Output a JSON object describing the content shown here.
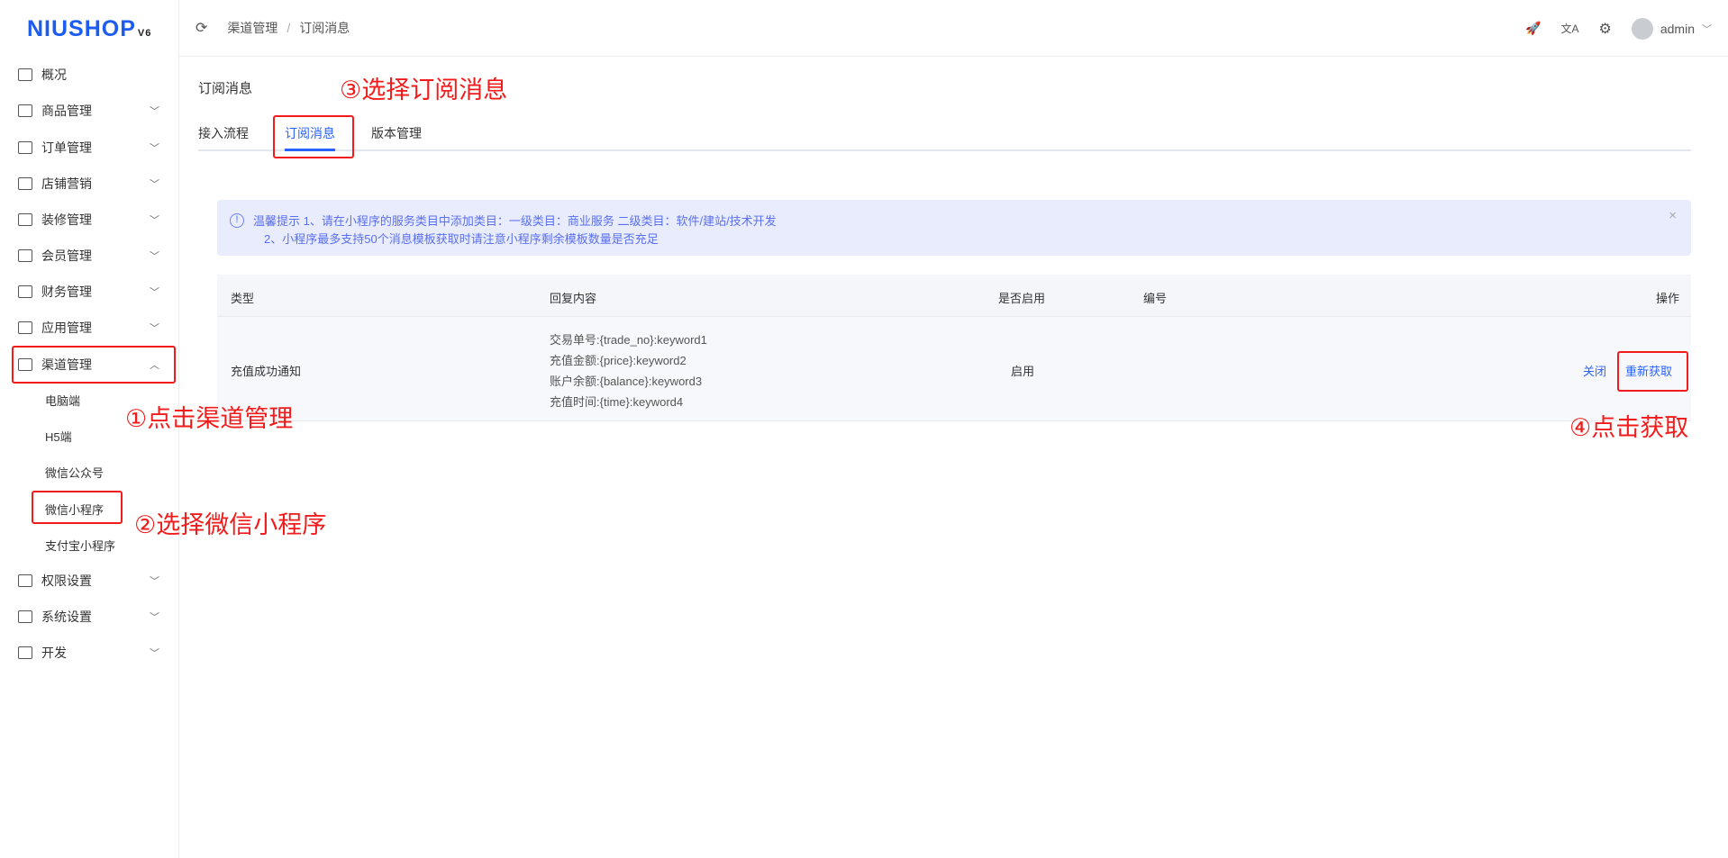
{
  "logo": {
    "text": "NIUSHOP",
    "version": "V6"
  },
  "sidebar": {
    "items": [
      {
        "label": "概况",
        "icon": "chart-icon"
      },
      {
        "label": "商品管理",
        "icon": "goods-icon"
      },
      {
        "label": "订单管理",
        "icon": "order-icon"
      },
      {
        "label": "店铺营销",
        "icon": "marketing-icon"
      },
      {
        "label": "装修管理",
        "icon": "decorate-icon"
      },
      {
        "label": "会员管理",
        "icon": "member-icon"
      },
      {
        "label": "财务管理",
        "icon": "finance-icon"
      },
      {
        "label": "应用管理",
        "icon": "app-icon"
      },
      {
        "label": "渠道管理",
        "icon": "channel-icon"
      },
      {
        "label": "权限设置",
        "icon": "permission-icon"
      },
      {
        "label": "系统设置",
        "icon": "settings-icon"
      },
      {
        "label": "开发",
        "icon": "develop-icon"
      }
    ],
    "channel_sub": [
      "电脑端",
      "H5端",
      "微信公众号",
      "微信小程序",
      "支付宝小程序"
    ]
  },
  "header": {
    "breadcrumb": [
      "渠道管理",
      "/",
      "订阅消息"
    ],
    "user": "admin"
  },
  "page": {
    "title": "订阅消息",
    "tabs": [
      "接入流程",
      "订阅消息",
      "版本管理"
    ]
  },
  "alert": {
    "line1": "温馨提示 1、请在小程序的服务类目中添加类目：一级类目：商业服务 二级类目：软件/建站/技术开发",
    "line2": "2、小程序最多支持50个消息模板获取时请注意小程序剩余模板数量是否充足",
    "close": "×"
  },
  "table": {
    "headers": [
      "类型",
      "回复内容",
      "是否启用",
      "编号",
      "操作"
    ],
    "rows": [
      {
        "type": "充值成功通知",
        "content": [
          "交易单号:{trade_no}:keyword1",
          "充值金额:{price}:keyword2",
          "账户余额:{balance}:keyword3",
          "充值时间:{time}:keyword4"
        ],
        "enabled": "启用",
        "number": "",
        "actions": [
          "关闭",
          "重新获取"
        ]
      }
    ]
  },
  "annotations": [
    "①点击渠道管理",
    "②选择微信小程序",
    "③选择订阅消息",
    "④点击获取"
  ]
}
